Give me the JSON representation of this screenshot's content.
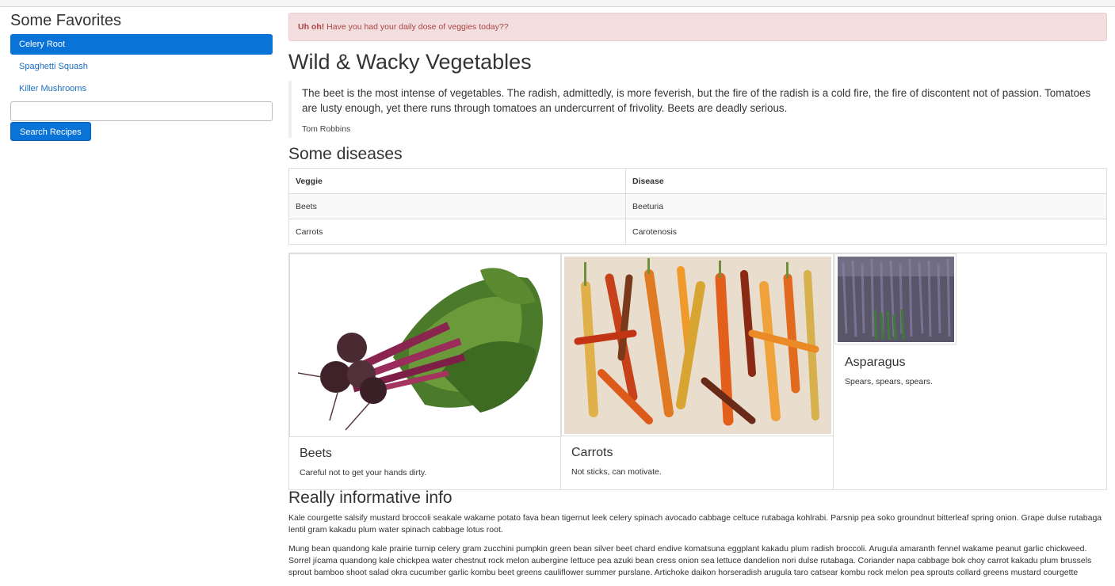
{
  "sidebar": {
    "title": "Some Favorites",
    "items": [
      {
        "label": "Celery Root"
      },
      {
        "label": "Spaghetti Squash"
      },
      {
        "label": "Killer Mushrooms"
      }
    ],
    "search_value": "",
    "search_button": "Search Recipes"
  },
  "alert": {
    "strong": "Uh oh!",
    "message": "Have you had your daily dose of veggies today??"
  },
  "main": {
    "title": "Wild & Wacky Vegetables",
    "quote": {
      "text": "The beet is the most intense of vegetables. The radish, admittedly, is more feverish, but the fire of the radish is a cold fire, the fire of discontent not of passion. Tomatoes are lusty enough, yet there runs through tomatoes an undercurrent of frivolity. Beets are deadly serious.",
      "author": "Tom Robbins"
    },
    "diseases_title": "Some diseases",
    "table": {
      "headers": [
        "Veggie",
        "Disease"
      ],
      "rows": [
        [
          "Beets",
          "Beeturia"
        ],
        [
          "Carrots",
          "Carotenosis"
        ]
      ]
    },
    "cards": [
      {
        "title": "Beets",
        "text": "Careful not to get your hands dirty."
      },
      {
        "title": "Carrots",
        "text": "Not sticks, can motivate."
      },
      {
        "title": "Asparagus",
        "text": "Spears, spears, spears."
      }
    ],
    "info_title": "Really informative info",
    "paragraphs": [
      "Kale courgette salsify mustard broccoli seakale wakame potato fava bean tigernut leek celery spinach avocado cabbage celtuce rutabaga kohlrabi. Parsnip pea soko groundnut bitterleaf spring onion. Grape dulse rutabaga lentil gram kakadu plum water spinach cabbage lotus root.",
      "Mung bean quandong kale prairie turnip celery gram zucchini pumpkin green bean silver beet chard endive komatsuna eggplant kakadu plum radish broccoli. Arugula amaranth fennel wakame peanut garlic chickweed. Sorrel jícama quandong kale chickpea water chestnut rock melon aubergine lettuce pea azuki bean cress onion sea lettuce dandelion nori dulse rutabaga. Coriander napa cabbage bok choy carrot kakadu plum brussels sprout bamboo shoot salad okra cucumber garlic kombu beet greens cauliflower summer purslane. Artichoke daikon horseradish arugula taro catsear kombu rock melon pea sprouts collard greens mustard courgette"
    ]
  },
  "colors": {
    "primary": "#0a73d8",
    "link": "#1a6fc0",
    "alert_bg": "#f2dede",
    "alert_text": "#a94442"
  }
}
